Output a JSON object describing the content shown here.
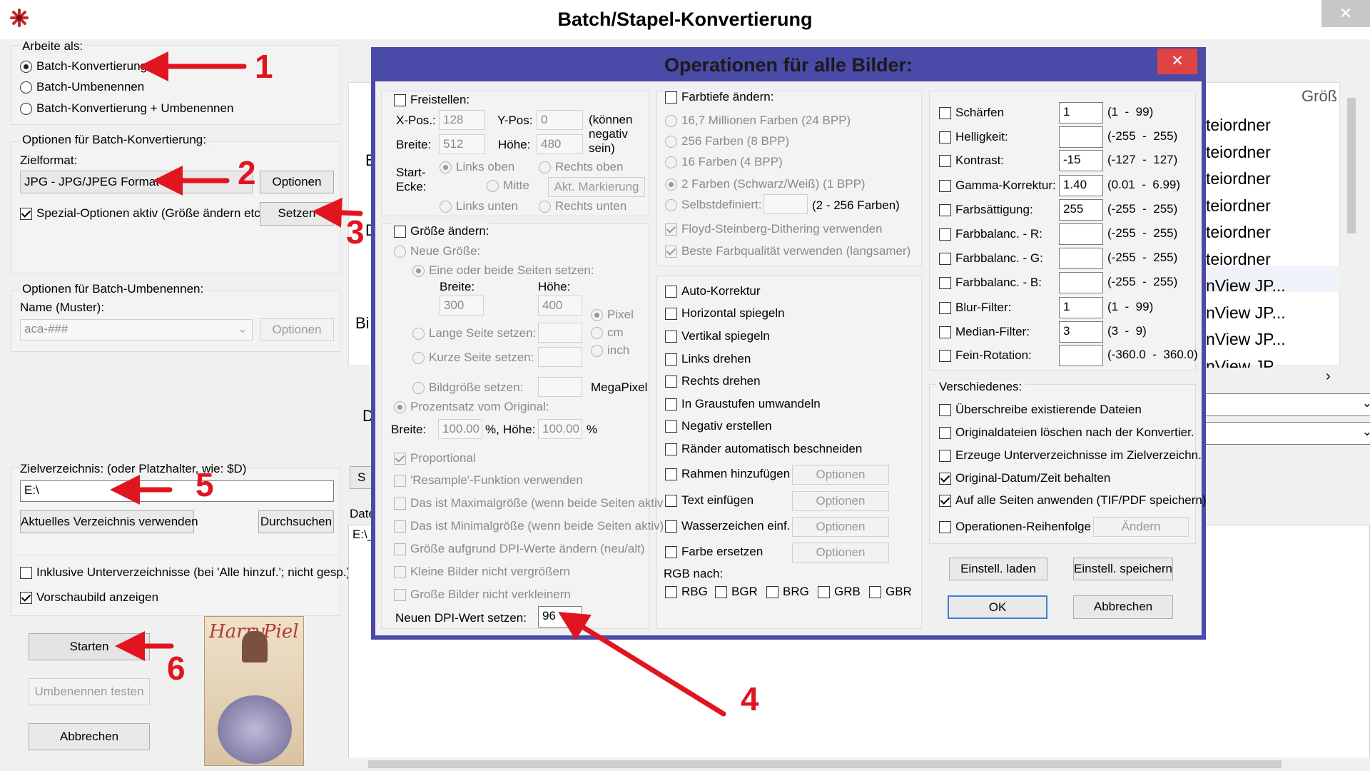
{
  "window": {
    "title": "Batch/Stapel-Konvertierung",
    "close_glyph": "✕"
  },
  "work": {
    "heading": "Arbeite als:",
    "opt1": "Batch-Konvertierung",
    "opt2": "Batch-Umbenennen",
    "opt3": "Batch-Konvertierung + Umbenennen"
  },
  "conv": {
    "heading": "Optionen für Batch-Konvertierung:",
    "target_label": "Zielformat:",
    "target_value": "JPG - JPG/JPEG Format",
    "options_btn": "Optionen",
    "special_label": "Spezial-Optionen aktiv (Größe ändern etc.)",
    "set_btn": "Setzen"
  },
  "rename": {
    "heading": "Optionen für Batch-Umbenennen:",
    "name_label": "Name (Muster):",
    "name_value": "aca-###",
    "options_btn": "Optionen"
  },
  "target_dir": {
    "label": "Zielverzeichnis: (oder Platzhalter, wie: $D)",
    "value": "E:\\",
    "current_btn": "Aktuelles Verzeichnis verwenden",
    "browse_btn": "Durchsuchen"
  },
  "misc_left": {
    "include_sub": "Inklusive Unterverzeichnisse (bei 'Alle hinzuf.'; nicht gesp.)",
    "preview": "Vorschaubild anzeigen"
  },
  "buttons": {
    "start": "Starten",
    "test_rename": "Umbenennen testen",
    "cancel": "Abbrechen"
  },
  "preview_img": {
    "title_line1": "Harry",
    "title_line2": "Piel"
  },
  "bg": {
    "list_header": "Größ",
    "list_items": [
      "teiordner",
      "teiordner",
      "teiordner",
      "teiordner",
      "teiordner",
      "teiordner",
      "nView JP...",
      "nView JP...",
      "nView JP...",
      "nView JP"
    ],
    "frag_b": "B",
    "frag_d": "D",
    "frag_bi": "Bi",
    "frag_d2": "D",
    "frag_s": "S",
    "frag_date": "Date",
    "frag_path": "E:\\_"
  },
  "dialog": {
    "title": "Operationen für alle Bilder:",
    "close_glyph": "✕",
    "crop": {
      "label": "Freistellen:",
      "xpos_label": "X-Pos.:",
      "xpos": "128",
      "ypos_label": "Y-Pos:",
      "ypos": "0",
      "neg_note1": "(können",
      "neg_note2": "negativ",
      "neg_note3": "sein)",
      "width_label": "Breite:",
      "width": "512",
      "height_label": "Höhe:",
      "height": "480",
      "start_label1": "Start-",
      "start_label2": "Ecke:",
      "tl": "Links oben",
      "tr": "Rechts oben",
      "mid": "Mitte",
      "mark_btn": "Akt. Markierung",
      "bl": "Links unten",
      "br": "Rechts unten"
    },
    "resize": {
      "label": "Größe ändern:",
      "new_size": "Neue Größe:",
      "one_or_both": "Eine oder beide Seiten setzen:",
      "w_label": "Breite:",
      "h_label": "Höhe:",
      "w": "300",
      "h": "400",
      "pixel": "Pixel",
      "cm": "cm",
      "inch": "inch",
      "long_side": "Lange Seite setzen:",
      "short_side": "Kurze Seite setzen:",
      "img_size": "Bildgröße setzen:",
      "megapixel": "MegaPixel",
      "percent": "Prozentsatz vom Original:",
      "pw_label": "Breite:",
      "pw": "100.00",
      "pct1": "%,",
      "ph_label": "Höhe:",
      "ph": "100.00",
      "pct2": "%",
      "proportional": "Proportional",
      "resample": "'Resample'-Funktion verwenden",
      "max_size": "Das ist Maximalgröße (wenn beide Seiten aktiv",
      "min_size": "Das ist Minimalgröße (wenn beide Seiten aktiv)",
      "dpi_change": "Größe aufgrund DPI-Werte ändern (neu/alt)",
      "no_enlarge": "Kleine Bilder nicht vergrößern",
      "no_shrink": "Große Bilder nicht verkleinern",
      "dpi_label": "Neuen DPI-Wert setzen:",
      "dpi": "96"
    },
    "depth": {
      "label": "Farbtiefe ändern:",
      "c24": "16,7 Millionen Farben (24 BPP)",
      "c256": "256 Farben (8 BPP)",
      "c16": "16 Farben (4 BPP)",
      "c2": "2 Farben (Schwarz/Weiß) (1 BPP)",
      "custom": "Selbstdefiniert:",
      "custom_range": "(2 - 256 Farben)",
      "floyd": "Floyd-Steinberg-Dithering verwenden",
      "best": "Beste Farbqualität verwenden (langsamer)"
    },
    "ops": {
      "auto": "Auto-Korrektur",
      "hflip": "Horizontal spiegeln",
      "vflip": "Vertikal spiegeln",
      "rotl": "Links drehen",
      "rotr": "Rechts drehen",
      "gray": "In Graustufen umwandeln",
      "neg": "Negativ erstellen",
      "autocrop": "Ränder automatisch beschneiden",
      "frame": "Rahmen hinzufügen",
      "text": "Text einfügen",
      "watermark": "Wasserzeichen einf.",
      "replace": "Farbe ersetzen",
      "options": "Optionen",
      "rgb_label": "RGB nach:",
      "rbg": "RBG",
      "bgr": "BGR",
      "brg": "BRG",
      "grb": "GRB",
      "gbr": "GBR"
    },
    "adjust": [
      {
        "label": "Schärfen",
        "value": "1",
        "range": "(1  -  99)",
        "checked": false
      },
      {
        "label": "Helligkeit:",
        "value": "",
        "range": "(-255  -  255)",
        "checked": false
      },
      {
        "label": "Kontrast:",
        "value": "-15",
        "range": "(-127  -  127)",
        "checked": false
      },
      {
        "label": "Gamma-Korrektur:",
        "value": "1.40",
        "range": "(0.01  -  6.99)",
        "checked": false
      },
      {
        "label": "Farbsättigung:",
        "value": "255",
        "range": "(-255  -  255)",
        "checked": false
      },
      {
        "label": "Farbbalanc. - R:",
        "value": "",
        "range": "(-255  -  255)",
        "checked": false
      },
      {
        "label": "Farbbalanc. - G:",
        "value": "",
        "range": "(-255  -  255)",
        "checked": false
      },
      {
        "label": "Farbbalanc. - B:",
        "value": "",
        "range": "(-255  -  255)",
        "checked": false
      },
      {
        "label": "Blur-Filter:",
        "value": "1",
        "range": "(1  -  99)",
        "checked": false
      },
      {
        "label": "Median-Filter:",
        "value": "3",
        "range": "(3  -  9)",
        "checked": false
      },
      {
        "label": "Fein-Rotation:",
        "value": "",
        "range": "(-360.0  -  360.0)",
        "checked": false
      }
    ],
    "misc": {
      "heading": "Verschiedenes:",
      "overwrite": "Überschreibe existierende Dateien",
      "delete_orig": "Originaldateien löschen nach der Konvertier.",
      "subdirs": "Erzeuge Unterverzeichnisse im Zielverzeichn.",
      "keep_date": "Original-Datum/Zeit behalten",
      "all_pages": "Auf alle Seiten anwenden (TIF/PDF speichern)",
      "order": "Operationen-Reihenfolge",
      "change_btn": "Ändern"
    },
    "load_btn": "Einstell. laden",
    "save_btn": "Einstell. speichern",
    "ok_btn": "OK",
    "cancel_btn": "Abbrechen"
  },
  "annotations": {
    "n1": "1",
    "n2": "2",
    "n3": "3",
    "n4": "4",
    "n5": "5",
    "n6": "6",
    "color": "#e0151f"
  },
  "colors": {
    "dialog_border": "#4a4aa8",
    "dialog_title_bg": "#4a4aa8",
    "dialog_close": "#e04343",
    "panel": "#f0f0f0"
  }
}
